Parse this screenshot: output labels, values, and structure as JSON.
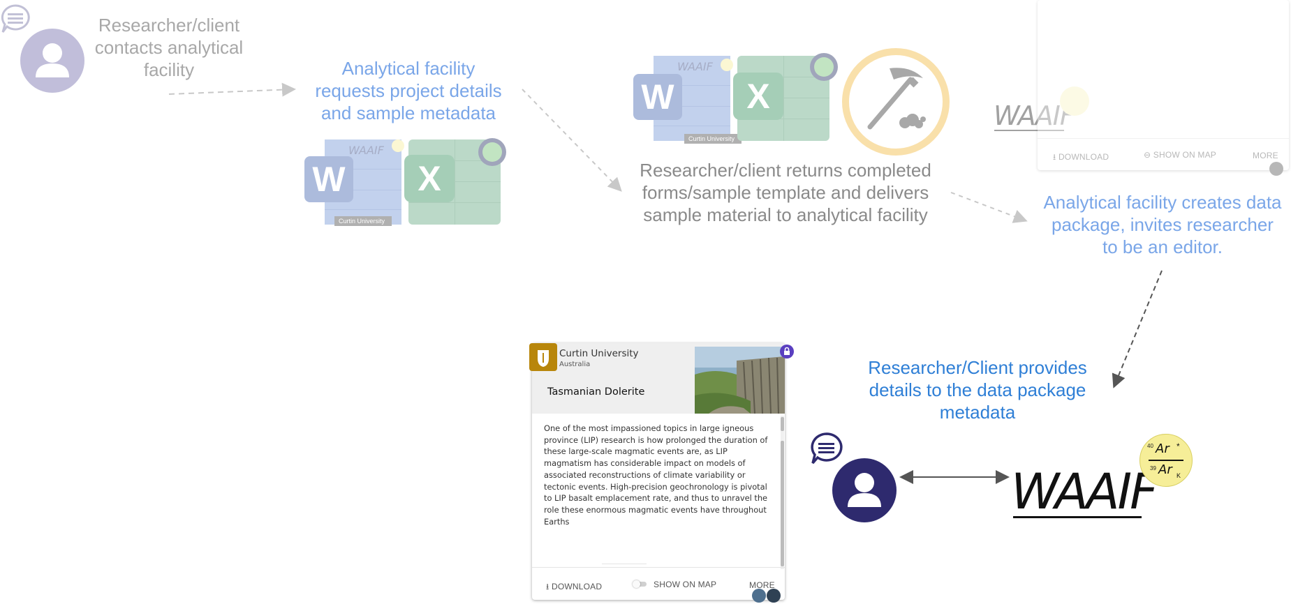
{
  "steps": {
    "step1": {
      "line1": "Researcher/client",
      "line2": "contacts analytical",
      "line3": "facility"
    },
    "step2": {
      "line1": "Analytical facility",
      "line2": "requests project details",
      "line3": "and sample metadata"
    },
    "step3": {
      "line1": "Researcher/client returns completed",
      "line2": "forms/sample template and delivers",
      "line3": "sample material to analytical facility"
    },
    "step4": {
      "line1": "Analytical facility creates data",
      "line2": "package, invites researcher",
      "line3": "to be an editor."
    },
    "step5": {
      "line1": "Researcher/Client provides",
      "line2": "details to the data package",
      "line3": "metadata"
    }
  },
  "docs": {
    "word_letter": "W",
    "excel_letter": "X",
    "doc_header": "WAAIF",
    "doc_footer": "Curtin University"
  },
  "logo": {
    "text": "WAAIF",
    "seal_top_num": "40",
    "seal_top": "Ar",
    "seal_bottom_num": "39",
    "seal_bottom": "Ar"
  },
  "card": {
    "institution": "Curtin University",
    "country": "Australia",
    "title": "Tasmanian Dolerite",
    "description": "One of the most impassioned topics in large igneous province (LIP) research is how prolonged the duration of these large-scale magmatic events are, as LIP magmatism has considerable impact on models of associated reconstructions of climate variability or tectonic events. High-precision geochronology is pivotal to LIP basalt emplacement rate, and thus to unravel the role these enormous magmatic events have throughout Earths",
    "download": "DOWNLOAD",
    "show_on_map": "SHOW ON MAP",
    "more": "MORE"
  },
  "colors": {
    "avatar_light": "#b9b5d2",
    "avatar_dark": "#2e2a6e",
    "word_blue": "#6f93d6",
    "excel_green": "#5ea57e",
    "hammer_ring": "#f7d27e",
    "seal_yellow": "#f6ee98",
    "lock_purple": "#5a3fc0",
    "curtin_gold": "#b8860b"
  },
  "icons": [
    "user-icon",
    "chat-icon",
    "word-icon",
    "excel-icon",
    "hammer-icon",
    "lock-icon",
    "download-icon",
    "toggle-icon",
    "arrow-icon"
  ]
}
